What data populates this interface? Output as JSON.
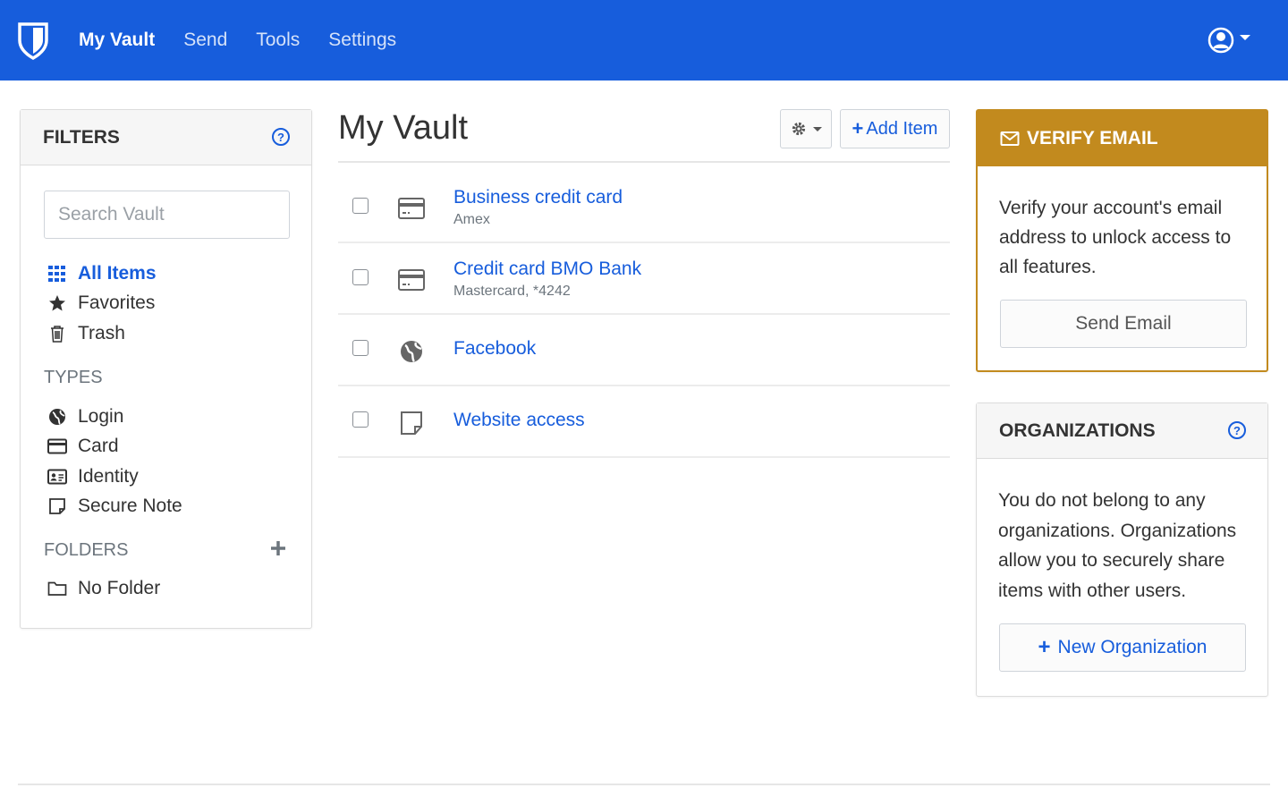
{
  "nav": {
    "links": [
      "My Vault",
      "Send",
      "Tools",
      "Settings"
    ]
  },
  "filters": {
    "header": "FILTERS",
    "search_placeholder": "Search Vault",
    "all_items": "All Items",
    "favorites": "Favorites",
    "trash": "Trash",
    "types_heading": "TYPES",
    "types": [
      "Login",
      "Card",
      "Identity",
      "Secure Note"
    ],
    "folders_heading": "FOLDERS",
    "no_folder": "No Folder"
  },
  "main": {
    "title": "My Vault",
    "add_item": "Add Item",
    "items": [
      {
        "name": "Business credit card",
        "sub": "Amex",
        "icon": "card-icon"
      },
      {
        "name": "Credit card BMO Bank",
        "sub": "Mastercard, *4242",
        "icon": "card-icon"
      },
      {
        "name": "Facebook",
        "sub": "",
        "icon": "globe-icon"
      },
      {
        "name": "Website access",
        "sub": "",
        "icon": "secure-note-icon"
      }
    ]
  },
  "verify": {
    "header": "VERIFY EMAIL",
    "text": "Verify your account's email address to unlock access to all features.",
    "button": "Send Email"
  },
  "organizations": {
    "header": "ORGANIZATIONS",
    "text": "You do not belong to any organizations. Organizations allow you to securely share items with other users.",
    "button": "New Organization"
  },
  "colors": {
    "brand": "#175ddc",
    "warning": "#c28a1e"
  }
}
